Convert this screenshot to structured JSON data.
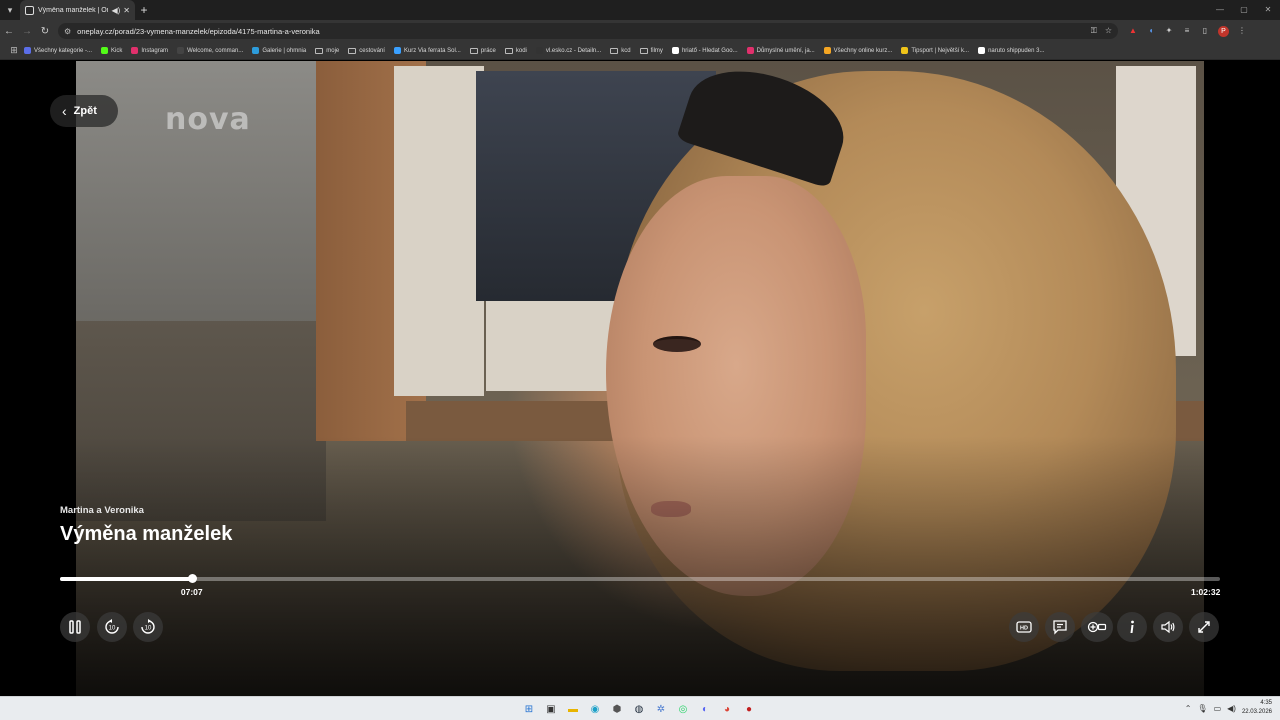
{
  "browser": {
    "tab_title": "Výměna manželek | Oneplay",
    "url": "oneplay.cz/porad/23-vymena-manzelek/epizoda/4175-martina-a-veronika",
    "bookmarks": [
      {
        "label": "Všechny kategorie -...",
        "color": "#5b6ee8",
        "type": "site"
      },
      {
        "label": "Kick",
        "color": "#53fc18",
        "type": "site"
      },
      {
        "label": "Instagram",
        "color": "#e1306c",
        "type": "site"
      },
      {
        "label": "Welcome, comman...",
        "color": "#444444",
        "type": "site"
      },
      {
        "label": "Galerie | ohmnia",
        "color": "#2d9cdb",
        "type": "site"
      },
      {
        "label": "moje",
        "color": "",
        "type": "folder"
      },
      {
        "label": "cestování",
        "color": "",
        "type": "folder"
      },
      {
        "label": "Kurz Via ferrata Sol...",
        "color": "#3aa0ff",
        "type": "site"
      },
      {
        "label": "práce",
        "color": "",
        "type": "folder"
      },
      {
        "label": "kodi",
        "color": "",
        "type": "folder"
      },
      {
        "label": "vl.esko.cz - Detailn...",
        "color": "#333333",
        "type": "site"
      },
      {
        "label": "kcd",
        "color": "",
        "type": "folder"
      },
      {
        "label": "filmy",
        "color": "",
        "type": "folder"
      },
      {
        "label": "hriatő - Hledat Goo...",
        "color": "#ffffff",
        "type": "site"
      },
      {
        "label": "Důmyslné umění, ja...",
        "color": "#e1306c",
        "type": "site"
      },
      {
        "label": "Všechny online kurz...",
        "color": "#f5a623",
        "type": "site"
      },
      {
        "label": "Tipsport | Největší k...",
        "color": "#f0c419",
        "type": "site"
      },
      {
        "label": "naruto shippuden 3...",
        "color": "#ffffff",
        "type": "site"
      }
    ],
    "profile_initial": "P"
  },
  "player": {
    "logo_text": "nova",
    "back_label": "Zpět",
    "episode_subtitle": "Martina a Veronika",
    "show_title": "Výměna manželek",
    "current_time": "07:07",
    "total_time": "1:02:32",
    "progress_fraction": 0.1137,
    "controls_left": [
      "pause-icon",
      "rewind-10-icon",
      "forward-10-icon"
    ],
    "controls_right": [
      "hd-icon",
      "subtitles-icon",
      "add-to-list-icon",
      "info-icon",
      "volume-icon",
      "fullscreen-icon"
    ],
    "skip_seconds": "10",
    "hd_label": "HD"
  },
  "taskbar": {
    "time": "4:35",
    "date": "22.03.2026"
  }
}
